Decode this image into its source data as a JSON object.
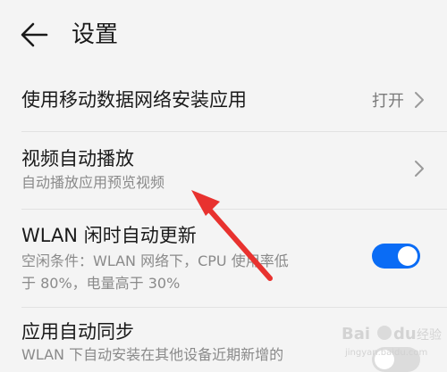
{
  "header": {
    "title": "设置"
  },
  "settings": [
    {
      "title": "使用移动数据网络安装应用",
      "value": "打开"
    },
    {
      "title": "视频自动播放",
      "subtitle": "自动播放应用预览视频"
    },
    {
      "title": "WLAN 闲时自动更新",
      "subtitle_line1": "空闲条件：WLAN 网络下，CPU 使用率低",
      "subtitle_line2": "于 80%，电量高于 30%",
      "toggle_on": true
    },
    {
      "title": "应用自动同步",
      "subtitle_line1": "WLAN 下自动安装在其他设备近期新增的"
    }
  ],
  "colors": {
    "accent": "#0a6cf5",
    "annotation_arrow": "#e8322f",
    "background": "#f4f4f4"
  },
  "watermark": {
    "text": "Bai du 经验",
    "subtext": "jingyan.baidu.com"
  }
}
